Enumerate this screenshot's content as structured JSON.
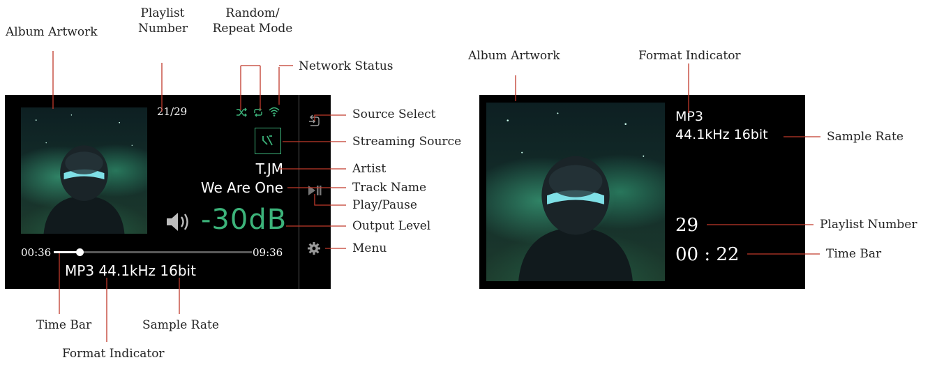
{
  "left_screen": {
    "playlist_number": "21/29",
    "artist": "T.JM",
    "track_name": "We Are One",
    "volume": "-30dB",
    "time_elapsed": "00:36",
    "time_total": "09:36",
    "progress_fraction": 0.13,
    "format_line": "MP3 44.1kHz 16bit"
  },
  "right_screen": {
    "format": "MP3",
    "sample_rate": "44.1kHz 16bit",
    "playlist_number": "29",
    "time": "00 : 22"
  },
  "labels": {
    "album_artwork_left": "Album Artwork",
    "playlist_number_left_1": "Playlist",
    "playlist_number_left_2": "Number",
    "random_repeat_1": "Random/",
    "random_repeat_2": "Repeat Mode",
    "network_status": "Network Status",
    "source_select": "Source Select",
    "streaming_source": "Streaming Source",
    "artist": "Artist",
    "track_name": "Track Name",
    "play_pause": "Play/Pause",
    "output_level": "Output Level",
    "menu": "Menu",
    "time_bar_left": "Time Bar",
    "sample_rate_left": "Sample Rate",
    "format_indicator_left": "Format Indicator",
    "album_artwork_right": "Album Artwork",
    "format_indicator_right": "Format Indicator",
    "sample_rate_right": "Sample Rate",
    "playlist_number_right": "Playlist Number",
    "time_bar_right": "Time Bar"
  },
  "colors": {
    "accent_green": "#3cb37a",
    "callout_line": "#c0392b",
    "screen_bg": "#000000"
  },
  "icons": [
    "shuffle-icon",
    "repeat-icon",
    "wifi-icon",
    "source-select-icon",
    "streaming-source-icon",
    "play-pause-icon",
    "speaker-icon",
    "gear-icon"
  ]
}
